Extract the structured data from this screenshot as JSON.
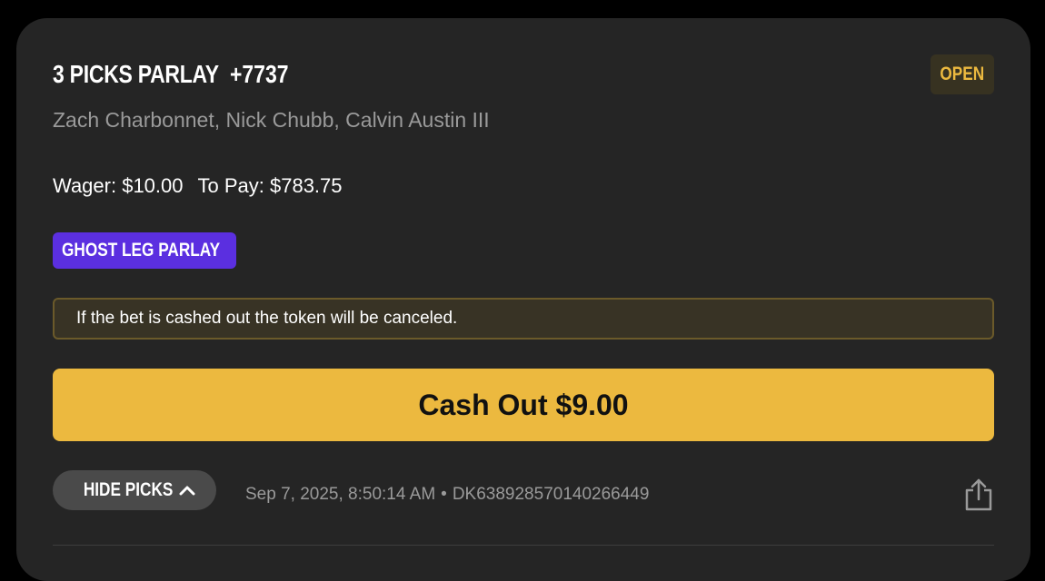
{
  "bet": {
    "title": "3 PICKS PARLAY",
    "odds": "+7737",
    "status": "OPEN",
    "players": "Zach Charbonnet, Nick Chubb, Calvin Austin III",
    "wager": "Wager: $10.00",
    "to_pay": "To Pay: $783.75",
    "badge": "GHOST LEG PARLAY",
    "notice": "If the bet is cashed out the token will be canceled.",
    "cashout_label": "Cash Out $9.00",
    "hide_picks_label": "HIDE PICKS",
    "timestamp": "Sep 7, 2025, 8:50:14 AM",
    "separator": "•",
    "bet_id": "DK638928570140266449"
  },
  "icons": {
    "hide_picks": "chevron-up-icon",
    "share": "share-icon"
  },
  "colors": {
    "background": "#000000",
    "card": "#252525",
    "accent": "#ecb93f",
    "ghost_badge": "#5b2fe0",
    "notice_bg": "#383325",
    "notice_border": "#6b5a2a",
    "muted_text": "#9a9a9a"
  }
}
